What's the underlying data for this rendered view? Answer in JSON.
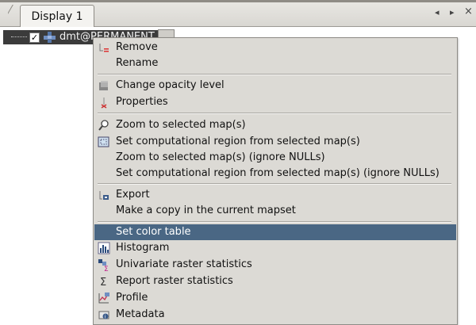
{
  "tabbar": {
    "tab_label": "Display 1",
    "nav_left": "◂",
    "nav_right": "▸",
    "nav_close": "×"
  },
  "layer": {
    "name": "dmt@PERMANENT",
    "checked": "✓"
  },
  "menu": {
    "items": [
      {
        "label": "Remove",
        "icon": "remove-icon"
      },
      {
        "label": "Rename",
        "icon": ""
      },
      {
        "label": "Change opacity level",
        "icon": "opacity-icon"
      },
      {
        "label": "Properties",
        "icon": "properties-icon"
      },
      {
        "label": "Zoom to selected map(s)",
        "icon": "zoom-icon"
      },
      {
        "label": "Set computational region from selected map(s)",
        "icon": "region-icon"
      },
      {
        "label": "Zoom to selected map(s) (ignore NULLs)",
        "icon": ""
      },
      {
        "label": "Set computational region from selected map(s) (ignore NULLs)",
        "icon": ""
      },
      {
        "label": "Export",
        "icon": "export-icon"
      },
      {
        "label": "Make a copy in the current mapset",
        "icon": ""
      },
      {
        "label": "Set color table",
        "icon": "",
        "highlighted": true
      },
      {
        "label": "Histogram",
        "icon": "histogram-icon"
      },
      {
        "label": "Univariate raster statistics",
        "icon": "univariate-stats-icon"
      },
      {
        "label": "Report raster statistics",
        "icon": "sigma-icon"
      },
      {
        "label": "Profile",
        "icon": "profile-icon"
      },
      {
        "label": "Metadata",
        "icon": "metadata-icon"
      }
    ]
  },
  "colors": {
    "highlight": "#4a6784",
    "menu_bg": "#dcdad5",
    "layer_row_bg": "#3b3b3b"
  }
}
